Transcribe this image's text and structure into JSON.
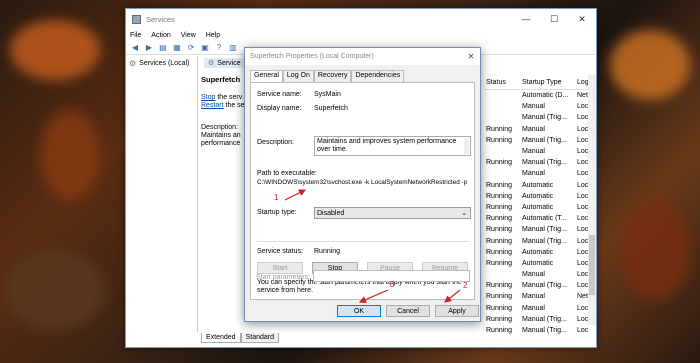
{
  "window": {
    "title": "Services",
    "controls": {
      "minimize": "—",
      "maximize": "☐",
      "close": "✕"
    },
    "menu": [
      "File",
      "Action",
      "View",
      "Help"
    ]
  },
  "left_pane": {
    "tree_item": "Services (Local)"
  },
  "services_header_tab": "Service",
  "service_detail": {
    "name": "Superfetch",
    "stop_link": "Stop",
    "stop_suffix": " the serv",
    "restart_link": "Restart",
    "restart_suffix": " the se",
    "description_label": "Description:",
    "description_line1": "Maintains an",
    "description_line2": "performance"
  },
  "table": {
    "headers": {
      "status": "Status",
      "startup": "Startup Type",
      "log": "Log"
    },
    "rows": [
      {
        "status": "",
        "startup": "Automatic (D...",
        "log": "Net"
      },
      {
        "status": "",
        "startup": "Manual",
        "log": "Loc"
      },
      {
        "status": "",
        "startup": "Manual (Trig...",
        "log": "Loc"
      },
      {
        "status": "Running",
        "startup": "Manual",
        "log": "Loc"
      },
      {
        "status": "Running",
        "startup": "Manual (Trig...",
        "log": "Loc"
      },
      {
        "status": "",
        "startup": "Manual",
        "log": "Loc"
      },
      {
        "status": "Running",
        "startup": "Manual (Trig...",
        "log": "Loc"
      },
      {
        "status": "",
        "startup": "Manual",
        "log": "Loc"
      },
      {
        "status": "Running",
        "startup": "Automatic",
        "log": "Loc"
      },
      {
        "status": "Running",
        "startup": "Automatic",
        "log": "Loc"
      },
      {
        "status": "Running",
        "startup": "Automatic",
        "log": "Loc"
      },
      {
        "status": "Running",
        "startup": "Automatic (T...",
        "log": "Loc"
      },
      {
        "status": "Running",
        "startup": "Manual (Trig...",
        "log": "Loc"
      },
      {
        "status": "Running",
        "startup": "Manual (Trig...",
        "log": "Loc"
      },
      {
        "status": "Running",
        "startup": "Automatic",
        "log": "Loc"
      },
      {
        "status": "Running",
        "startup": "Automatic",
        "log": "Loc"
      },
      {
        "status": "",
        "startup": "Manual",
        "log": "Loc"
      },
      {
        "status": "Running",
        "startup": "Manual (Trig...",
        "log": "Loc"
      },
      {
        "status": "Running",
        "startup": "Manual",
        "log": "Net"
      },
      {
        "status": "Running",
        "startup": "Manual",
        "log": "Loc"
      },
      {
        "status": "Running",
        "startup": "Manual (Trig...",
        "log": "Loc"
      },
      {
        "status": "Running",
        "startup": "Manual (Trig...",
        "log": "Loc"
      }
    ]
  },
  "bottom_tabs": {
    "extended": "Extended",
    "standard": "Standard"
  },
  "dialog": {
    "title": "Superfetch Properties (Local Computer)",
    "close": "✕",
    "tabs": [
      "General",
      "Log On",
      "Recovery",
      "Dependencies"
    ],
    "service_name_label": "Service name:",
    "service_name": "SysMain",
    "display_name_label": "Display name:",
    "display_name": "Superfetch",
    "description_label": "Description:",
    "description": "Maintains and improves system performance over time.",
    "path_label": "Path to executable:",
    "path": "C:\\WINDOWS\\system32\\svchost.exe -k LocalSystemNetworkRestricted -p",
    "startup_type_label": "Startup type:",
    "startup_type": "Disabled",
    "service_status_label": "Service status:",
    "service_status": "Running",
    "buttons": {
      "start": "Start",
      "stop": "Stop",
      "pause": "Pause",
      "resume": "Resume"
    },
    "help_text": "You can specify the start parameters that apply when you start the service from here.",
    "start_params_label": "Start parameters:",
    "ok": "OK",
    "cancel": "Cancel",
    "apply": "Apply"
  },
  "annotations": {
    "one": "1",
    "two": "2",
    "three": "3",
    "color": "#d32121"
  }
}
